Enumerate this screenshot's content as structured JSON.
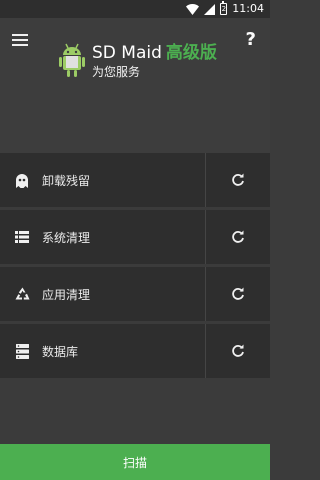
{
  "status_bar": {
    "time": "11:04",
    "battery_level": "2"
  },
  "header": {
    "app_name": "SD Maid",
    "pro_label": "高级版",
    "subtitle": "为您服务",
    "help_label": "?"
  },
  "tools": [
    {
      "label": "卸载残留",
      "icon": "ghost-icon"
    },
    {
      "label": "系统清理",
      "icon": "list-icon"
    },
    {
      "label": "应用清理",
      "icon": "recycle-icon"
    },
    {
      "label": "数据库",
      "icon": "database-icon"
    }
  ],
  "scan_button": {
    "label": "扫描"
  },
  "colors": {
    "accent": "#4caf50",
    "background": "#3b3b3b",
    "row": "#2e2e2e"
  }
}
